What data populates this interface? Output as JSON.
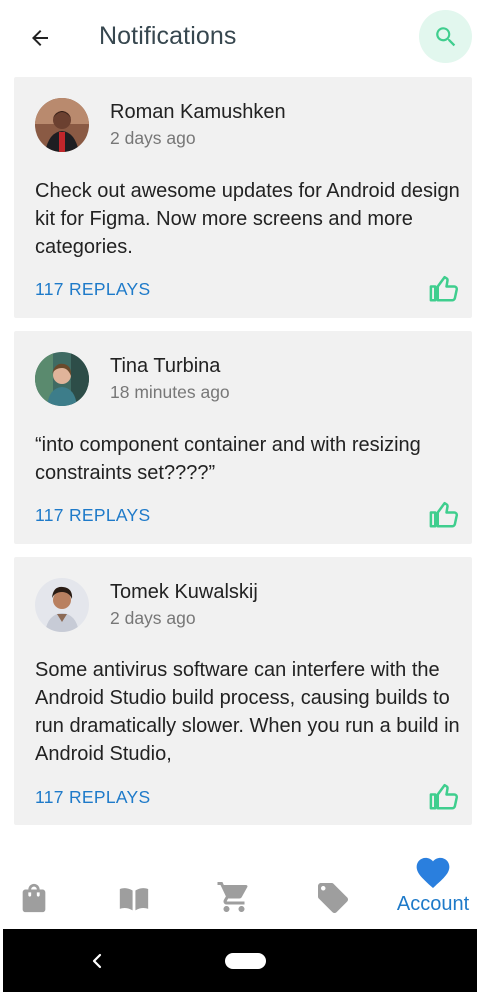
{
  "header": {
    "title": "Notifications",
    "back_icon": "arrow-left-icon",
    "search_icon": "search-icon"
  },
  "notifications": [
    {
      "author": "Roman Kamushken",
      "time": "2 days ago",
      "text": "Check out awesome updates for Android design kit for Figma. Now more screens and more categories.",
      "replies": "117 REPLAYS"
    },
    {
      "author": "Tina Turbina",
      "time": "18 minutes ago",
      "text": "“into component container and with resizing constraints set????”",
      "replies": "117 REPLAYS"
    },
    {
      "author": "Tomek Kuwalskij",
      "time": "2 days ago",
      "text": "Some antivirus software can interfere with the Android Studio build process, causing builds to run dramatically slower. When you run a build in Android Studio,",
      "replies": "117 REPLAYS"
    }
  ],
  "bottom_nav": {
    "items": [
      {
        "icon": "shopping-bag-icon",
        "label": ""
      },
      {
        "icon": "book-icon",
        "label": ""
      },
      {
        "icon": "cart-icon",
        "label": ""
      },
      {
        "icon": "tag-icon",
        "label": ""
      },
      {
        "icon": "heart-icon",
        "label": "Account",
        "active": true
      }
    ]
  },
  "colors": {
    "accent": "#1e7ac9",
    "like": "#3fce8e",
    "card": "#f1f1f1",
    "search_bg": "#e2f7ee",
    "nav_icon": "#9e9e9e",
    "active_heart": "#2a7fde"
  }
}
